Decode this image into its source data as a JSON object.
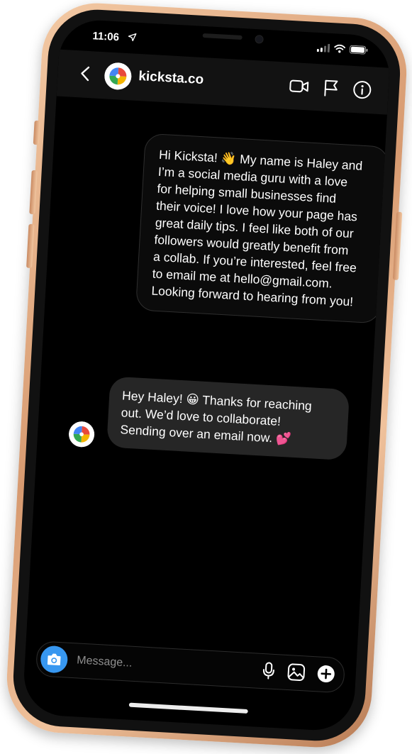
{
  "status_bar": {
    "time": "11:06",
    "icons": [
      "location-arrow-icon",
      "signal-icon",
      "wifi-icon",
      "battery-icon"
    ]
  },
  "header": {
    "contact_name": "kicksta.co",
    "icons": [
      "back-chevron-icon",
      "video-call-icon",
      "flag-icon",
      "info-icon"
    ]
  },
  "messages": [
    {
      "direction": "outgoing",
      "lines": [
        "Hi Kicksta! 👋 My name is Haley and",
        "I’m a social media guru with a love",
        "for helping small businesses find",
        "their voice! I love how your page has",
        "great daily tips. I feel like both of our",
        "followers would greatly benefit from",
        "a collab. If you’re interested, feel free",
        "to email me at hello@gmail.com.",
        "Looking forward to hearing from you!"
      ]
    },
    {
      "direction": "incoming",
      "lines": [
        "Hey Haley! 😀 Thanks for reaching",
        "out. We’d love to collaborate!",
        "Sending over an email now. 💕"
      ]
    }
  ],
  "composer": {
    "placeholder": "Message...",
    "icons": [
      "camera-icon",
      "microphone-icon",
      "gallery-icon",
      "add-icon"
    ]
  },
  "colors": {
    "background": "#000000",
    "accent": "#3797f0",
    "incoming_bubble": "#262626",
    "outgoing_bubble_border": "#2e2e2e",
    "phone_frame": "#d79a70"
  }
}
